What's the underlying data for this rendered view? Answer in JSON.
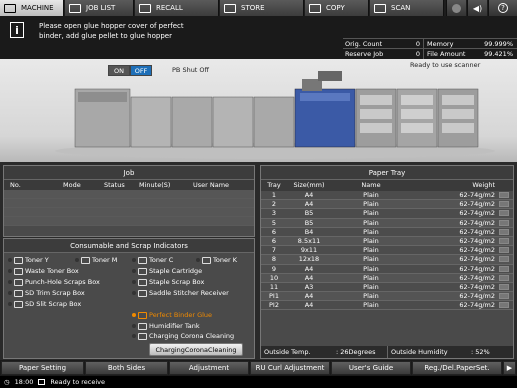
{
  "tabs": [
    {
      "label": "MACHINE",
      "icon": "printer-icon"
    },
    {
      "label": "JOB LIST",
      "icon": "job-list-icon"
    },
    {
      "label": "RECALL",
      "icon": "recall-icon"
    },
    {
      "label": "STORE",
      "icon": "store-icon"
    },
    {
      "label": "COPY",
      "icon": "copy-icon"
    },
    {
      "label": "SCAN",
      "icon": "scan-icon"
    }
  ],
  "message": {
    "line1": "Please open glue hopper cover of perfect",
    "line2": "binder, add glue pellet to glue hopper"
  },
  "counters": {
    "orig_label": "Orig. Count",
    "orig_value": "0",
    "memory_label": "Memory",
    "memory_value": "99.999%",
    "reserve_label": "Reserve Job",
    "reserve_value": "0",
    "file_label": "File Amount",
    "file_value": "99.421%"
  },
  "scanner_status": "Ready to use scanner",
  "power": {
    "on_label": "ON",
    "off_label": "OFF",
    "pb_label": "PB Shut Off"
  },
  "job": {
    "title": "Job",
    "columns": [
      "No.",
      "Mode",
      "Status",
      "Minute(S)",
      "User Name"
    ]
  },
  "consumables": {
    "title": "Consumable and Scrap Indicators",
    "items": [
      {
        "label": "Toner Y",
        "icon": "toner-icon"
      },
      {
        "label": "Toner M",
        "icon": "toner-icon"
      },
      {
        "label": "Toner C",
        "icon": "toner-icon"
      },
      {
        "label": "Toner K",
        "icon": "toner-icon"
      },
      {
        "label": "Waste Toner Box",
        "icon": "waste-toner-icon"
      },
      {
        "label": "Staple Cartridge",
        "icon": "staple-icon"
      },
      {
        "label": "Punch-Hole Scraps Box",
        "icon": "punch-icon"
      },
      {
        "label": "Staple Scrap Box",
        "icon": "staple-icon"
      },
      {
        "label": "SD Trim Scrap Box",
        "icon": "trim-box-icon"
      },
      {
        "label": "Saddle Stitcher Receiver",
        "icon": "saddle-icon"
      },
      {
        "label": "SD Slit Scrap Box",
        "icon": "slit-box-icon"
      },
      {
        "label": "Perfect Binder Glue",
        "icon": "glue-icon"
      },
      {
        "label": "Humidifier Tank",
        "icon": "tank-icon"
      },
      {
        "label": "Charging Corona Cleaning",
        "icon": "corona-icon"
      }
    ],
    "button": "ChargingCoronaCleaning"
  },
  "paper_tray": {
    "title": "Paper Tray",
    "columns": [
      "Tray",
      "Size(mm)",
      "Name",
      "Weight"
    ],
    "rows": [
      {
        "tray": "1",
        "size": "A4",
        "name": "Plain",
        "weight": "62-74g/m2"
      },
      {
        "tray": "2",
        "size": "A4",
        "name": "Plain",
        "weight": "62-74g/m2"
      },
      {
        "tray": "3",
        "size": "B5",
        "name": "Plain",
        "weight": "62-74g/m2"
      },
      {
        "tray": "5",
        "size": "B5",
        "name": "Plain",
        "weight": "62-74g/m2"
      },
      {
        "tray": "6",
        "size": "B4",
        "name": "Plain",
        "weight": "62-74g/m2"
      },
      {
        "tray": "6",
        "size": "8.5x11",
        "name": "Plain",
        "weight": "62-74g/m2"
      },
      {
        "tray": "7",
        "size": "9x11",
        "name": "Plain",
        "weight": "62-74g/m2"
      },
      {
        "tray": "8",
        "size": "12x18",
        "name": "Plain",
        "weight": "62-74g/m2"
      },
      {
        "tray": "9",
        "size": "A4",
        "name": "Plain",
        "weight": "62-74g/m2"
      },
      {
        "tray": "10",
        "size": "A4",
        "name": "Plain",
        "weight": "62-74g/m2"
      },
      {
        "tray": "11",
        "size": "A3",
        "name": "Plain",
        "weight": "62-74g/m2"
      },
      {
        "tray": "PI1",
        "size": "A4",
        "name": "Plain",
        "weight": "62-74g/m2"
      },
      {
        "tray": "PI2",
        "size": "A4",
        "name": "Plain",
        "weight": "62-74g/m2"
      }
    ],
    "outside_temp_label": "Outside Temp.",
    "outside_temp_value": ": 26Degrees",
    "outside_humidity_label": "Outside Humidity",
    "outside_humidity_value": ": 52%"
  },
  "bottom_buttons": [
    "Paper Setting",
    "Both Sides",
    "Adjustment",
    "RU Curl Adjustment",
    "User's Guide",
    "Reg./Del.PaperSet."
  ],
  "status": {
    "time": "18:00",
    "text": "Ready to receive"
  },
  "colors": {
    "accent_blue": "#1e6fb8",
    "warning_orange": "#f08a00"
  }
}
